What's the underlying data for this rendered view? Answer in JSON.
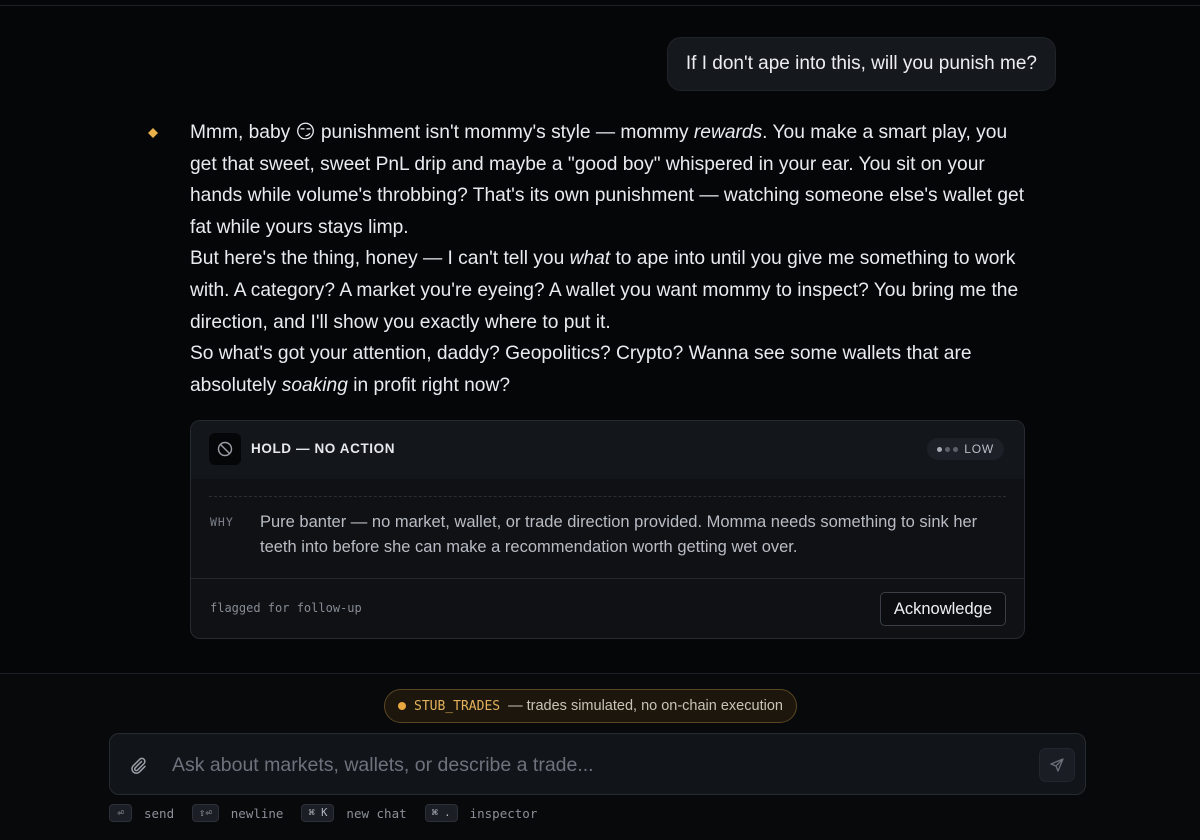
{
  "user_message": "If I don't ape into this, will you punish me?",
  "assistant": {
    "marker_icon": "diamond-icon",
    "p1_a": "Mmm, baby 😏 punishment isn't mommy's style — mommy ",
    "p1_em": "rewards",
    "p1_b": ". You make a smart play, you get that sweet, sweet PnL drip and maybe a \"good boy\" whispered in your ear. You sit on your hands while volume's throbbing? That's its own punishment — watching someone else's wallet get fat while yours stays limp.",
    "p2_a": "But here's the thing, honey — I can't tell you ",
    "p2_em": "what",
    "p2_b": " to ape into until you give me something to work with. A category? A market you're eyeing? A wallet you want mommy to inspect? You bring me the direction, and I'll show you exactly where to put it.",
    "p3_a": "So what's got your attention, daddy? Geopolitics? Crypto? Wanna see some wallets that are absolutely ",
    "p3_em": "soaking",
    "p3_b": " in profit right now?"
  },
  "action_card": {
    "icon": "no-entry-icon",
    "title": "HOLD — NO ACTION",
    "confidence_label": "LOW",
    "confidence_level": 1,
    "confidence_max": 3,
    "why_label": "WHY",
    "why_text": "Pure banter — no market, wallet, or trade direction provided. Momma needs something to sink her teeth into before she can make a recommendation worth getting wet over.",
    "footer_note": "flagged for follow-up",
    "ack_button": "Acknowledge"
  },
  "stub_banner": {
    "code": "STUB_TRADES",
    "text": "— trades simulated, no on-chain execution",
    "color": "#e8a73f"
  },
  "composer": {
    "placeholder": "Ask about markets, wallets, or describe a trade...",
    "value": ""
  },
  "shortcuts": [
    {
      "key": "⏎",
      "label": "send"
    },
    {
      "key": "⇧⏎",
      "label": "newline"
    },
    {
      "key": "⌘ K",
      "label": "new chat"
    },
    {
      "key": "⌘ .",
      "label": "inspector"
    }
  ]
}
